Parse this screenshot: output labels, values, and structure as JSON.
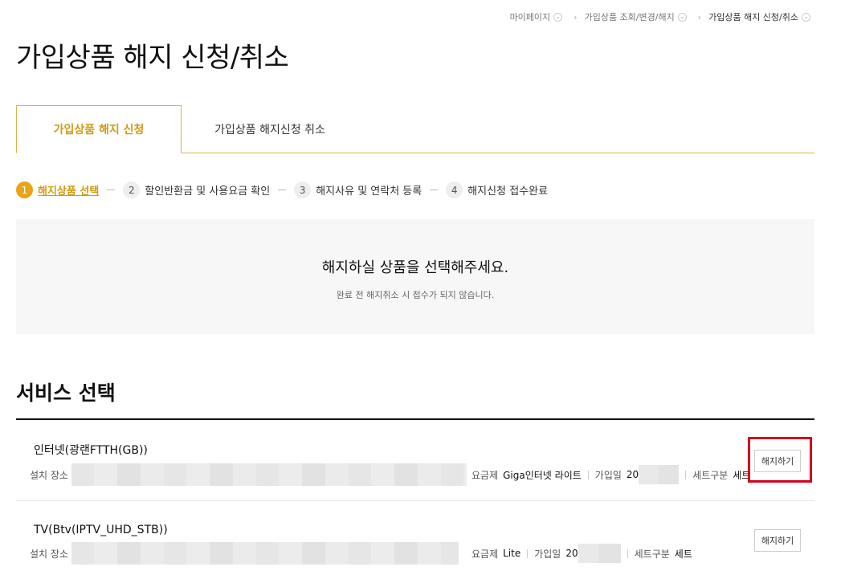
{
  "breadcrumb": [
    {
      "label": "마이페이지"
    },
    {
      "label": "가입상품 조회/변경/해지"
    },
    {
      "label": "가입상품 해지 신청/취소"
    }
  ],
  "page_title": "가입상품 해지 신청/취소",
  "tabs": [
    {
      "label": "가입상품 해지 신청",
      "active": true
    },
    {
      "label": "가입상품 해지신청 취소",
      "active": false
    }
  ],
  "steps": [
    {
      "num": "1",
      "label": "해지상품 선택"
    },
    {
      "num": "2",
      "label": "할인반환금 및 사용요금 확인"
    },
    {
      "num": "3",
      "label": "해지사유 및 연락처 등록"
    },
    {
      "num": "4",
      "label": "해지신청 접수완료"
    }
  ],
  "notice": {
    "title": "해지하실 상품을 선택해주세요.",
    "subtitle": "완료 전 해지취소 시 접수가 되지 않습니다."
  },
  "section_title": "서비스 선택",
  "services": [
    {
      "name": "인터넷(광랜FTTH(GB))",
      "location_label": "설치 장소",
      "plan_label": "요금제",
      "plan_value": "Giga인터넷 라이트",
      "join_label": "가입일",
      "join_value": "20",
      "set_label": "세트구분",
      "set_value": "세트",
      "button": "해지하기"
    },
    {
      "name": "TV(Btv(IPTV_UHD_STB))",
      "location_label": "설치 장소",
      "plan_label": "요금제",
      "plan_value": "Lite",
      "join_label": "가입일",
      "join_value": "20",
      "set_label": "세트구분",
      "set_value": "세트",
      "button": "해지하기"
    }
  ],
  "colors": {
    "accent": "#d29a11",
    "step_active": "#e8a317",
    "highlight": "#d4001a"
  }
}
